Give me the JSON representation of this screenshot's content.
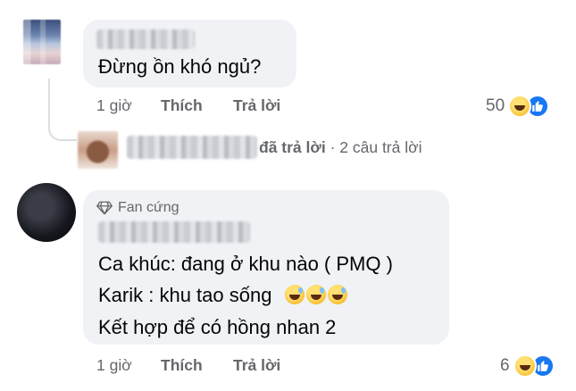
{
  "comment1": {
    "text": "Đừng ồn khó ngủ?",
    "time": "1 giờ",
    "like_label": "Thích",
    "reply_label": "Trả lời",
    "reaction_count": "50"
  },
  "reply_summary": {
    "action": "đã trả lời",
    "separator": "·",
    "count_text": "2 câu trả lời"
  },
  "comment2": {
    "badge": "Fan cứng",
    "lines": [
      "Ca khúc: đang ở khu nào ( PMQ )",
      "Karik : khu tao sống",
      "Kết hợp để có hồng nhan 2"
    ],
    "time": "1 giờ",
    "like_label": "Thích",
    "reply_label": "Trả lời",
    "reaction_count": "6"
  },
  "icons": {
    "badge": "diamond-icon",
    "emoji": "grinning-sweat-emoji-icon",
    "reactions": [
      "haha-reaction-icon",
      "like-reaction-icon"
    ]
  },
  "colors": {
    "bubble": "#f0f2f5",
    "meta_text": "#65676b",
    "like_blue": "#1877f2",
    "haha_yellow": "#f7b928"
  }
}
